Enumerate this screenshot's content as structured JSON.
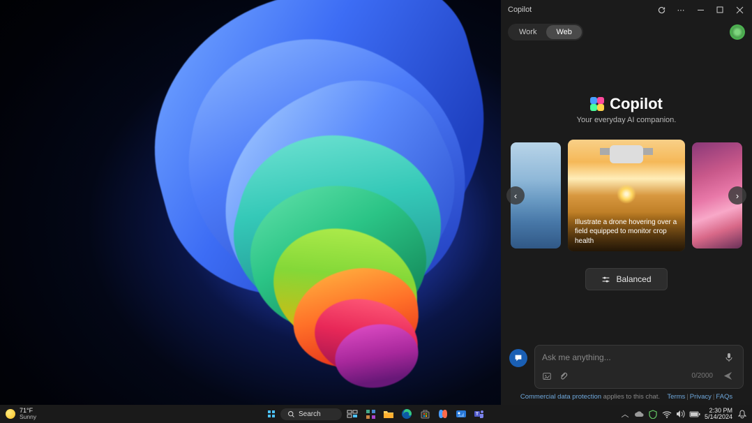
{
  "copilot": {
    "title": "Copilot",
    "tabs": {
      "work": "Work",
      "web": "Web"
    },
    "hero_name": "Copilot",
    "hero_sub": "Your everyday AI companion.",
    "card_caption": "Illustrate a drone hovering over a field equipped to monitor crop health",
    "balanced": "Balanced",
    "input_placeholder": "Ask me anything...",
    "counter": "0/2000",
    "legal": {
      "protection": "Commercial data protection",
      "applies": " applies to this chat.",
      "terms": "Terms",
      "privacy": "Privacy",
      "faqs": "FAQs"
    }
  },
  "taskbar": {
    "weather_temp": "71°F",
    "weather_cond": "Sunny",
    "search": "Search",
    "time": "2:30 PM",
    "date": "5/14/2024"
  }
}
